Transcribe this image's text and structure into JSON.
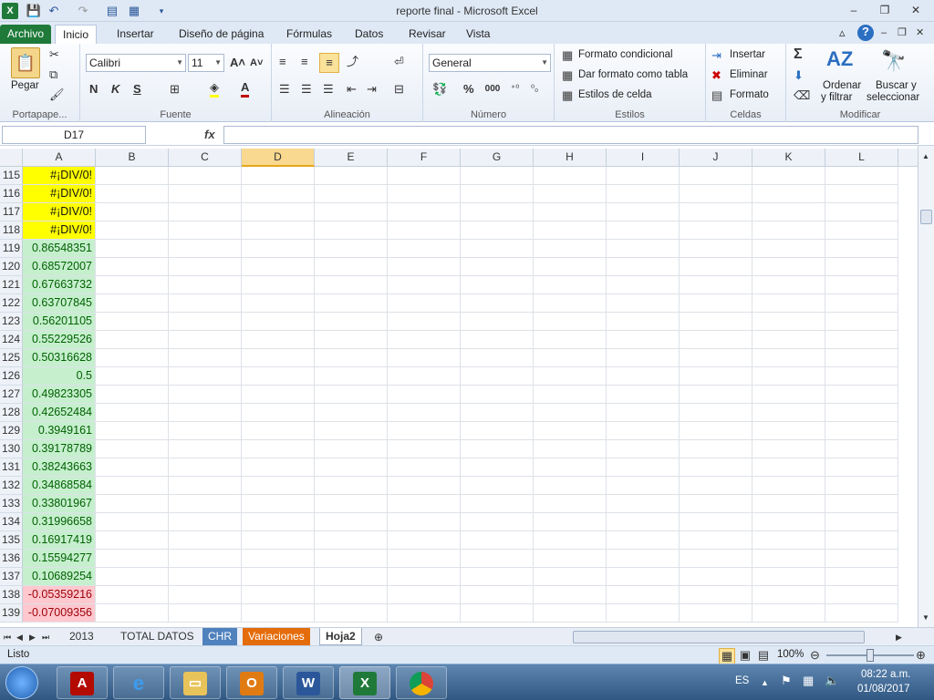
{
  "window": {
    "title": "reporte final  -  Microsoft Excel",
    "minimize": "‒",
    "restore": "❐",
    "close": "✕"
  },
  "ribbon_tabs": [
    "Archivo",
    "Inicio",
    "Insertar",
    "Diseño de página",
    "Fórmulas",
    "Datos",
    "Revisar",
    "Vista"
  ],
  "ribbon": {
    "portapapeles": {
      "pegar": "Pegar",
      "label": "Portapape..."
    },
    "fuente": {
      "font": "Calibri",
      "size": "11",
      "bold": "N",
      "italic": "K",
      "underline": "S",
      "label": "Fuente"
    },
    "alineacion": {
      "label": "Alineación"
    },
    "numero": {
      "format": "General",
      "percent": "%",
      "thousands": "000",
      "label": "Número"
    },
    "estilos": {
      "formato_condicional": "Formato condicional",
      "dar_formato": "Dar formato como tabla",
      "estilos_celda": "Estilos de celda",
      "label": "Estilos"
    },
    "celdas": {
      "insertar": "Insertar",
      "eliminar": "Eliminar",
      "formato": "Formato",
      "label": "Celdas"
    },
    "modificar": {
      "ordenar1": "Ordenar",
      "ordenar2": "y filtrar",
      "buscar1": "Buscar y",
      "buscar2": "seleccionar",
      "label": "Modificar"
    }
  },
  "formula_bar": {
    "name_box": "D17",
    "fx": "fx",
    "value": ""
  },
  "columns": [
    "A",
    "B",
    "C",
    "D",
    "E",
    "F",
    "G",
    "H",
    "I",
    "J",
    "K",
    "L"
  ],
  "selected_column": "D",
  "rows": [
    {
      "n": "115",
      "a": "#¡DIV/0!",
      "s": "err"
    },
    {
      "n": "116",
      "a": "#¡DIV/0!",
      "s": "err"
    },
    {
      "n": "117",
      "a": "#¡DIV/0!",
      "s": "err"
    },
    {
      "n": "118",
      "a": "#¡DIV/0!",
      "s": "err"
    },
    {
      "n": "119",
      "a": "0.86548351",
      "s": "pos"
    },
    {
      "n": "120",
      "a": "0.68572007",
      "s": "pos"
    },
    {
      "n": "121",
      "a": "0.67663732",
      "s": "pos"
    },
    {
      "n": "122",
      "a": "0.63707845",
      "s": "pos"
    },
    {
      "n": "123",
      "a": "0.56201105",
      "s": "pos"
    },
    {
      "n": "124",
      "a": "0.55229526",
      "s": "pos"
    },
    {
      "n": "125",
      "a": "0.50316628",
      "s": "pos"
    },
    {
      "n": "126",
      "a": "0.5",
      "s": "pos"
    },
    {
      "n": "127",
      "a": "0.49823305",
      "s": "pos"
    },
    {
      "n": "128",
      "a": "0.42652484",
      "s": "pos"
    },
    {
      "n": "129",
      "a": "0.3949161",
      "s": "pos"
    },
    {
      "n": "130",
      "a": "0.39178789",
      "s": "pos"
    },
    {
      "n": "131",
      "a": "0.38243663",
      "s": "pos"
    },
    {
      "n": "132",
      "a": "0.34868584",
      "s": "pos"
    },
    {
      "n": "133",
      "a": "0.33801967",
      "s": "pos"
    },
    {
      "n": "134",
      "a": "0.31996658",
      "s": "pos"
    },
    {
      "n": "135",
      "a": "0.16917419",
      "s": "pos"
    },
    {
      "n": "136",
      "a": "0.15594277",
      "s": "pos"
    },
    {
      "n": "137",
      "a": "0.10689254",
      "s": "pos"
    },
    {
      "n": "138",
      "a": "-0.05359216",
      "s": "neg"
    },
    {
      "n": "139",
      "a": "-0.07009356",
      "s": "neg"
    }
  ],
  "sheets": [
    {
      "name": "2013",
      "color": ""
    },
    {
      "name": "TOTAL DATOS",
      "color": ""
    },
    {
      "name": "CHR",
      "color": "#4f81bd"
    },
    {
      "name": "Variaciones",
      "color": "#e46c0a"
    },
    {
      "name": "Hoja2",
      "color": "",
      "active": true
    }
  ],
  "status": {
    "mode": "Listo",
    "zoom": "100%"
  },
  "taskbar": {
    "lang": "ES",
    "time": "08:22 a.m.",
    "date": "01/08/2017"
  },
  "colors": {
    "excel_green": "#1f7a3a",
    "error_fill": "#ffff00",
    "good_fill": "#c6efce",
    "bad_fill": "#ffc7ce"
  }
}
